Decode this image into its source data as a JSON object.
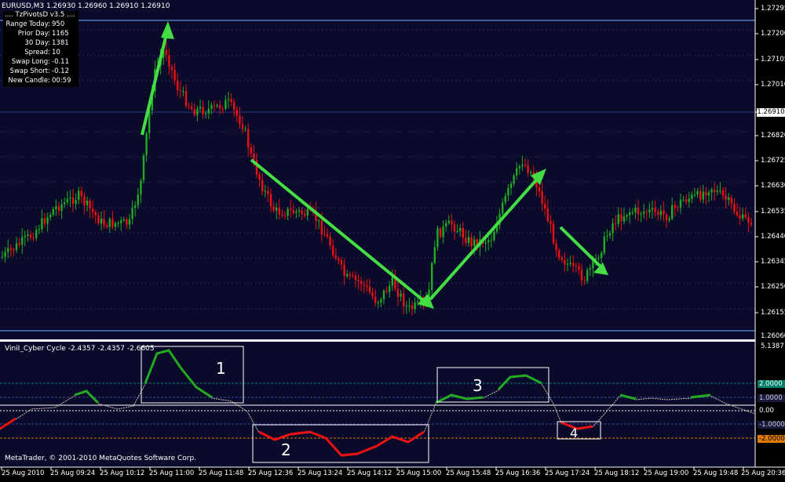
{
  "window": {
    "symbol_line": "EURUSD,M3  1.26930 1.26960 1.26910 1.26910",
    "indicator_title": "ViniI_Cyber Cycle -2.4357 -2.4357 -2.6605",
    "copyright": "MetaTrader, © 2001-2010 MetaQuotes Software Corp."
  },
  "pivots": {
    "header": ".... TzPivotsD v3.5 ....",
    "rows": [
      {
        "label": "Range Today:",
        "value": "950"
      },
      {
        "label": "Prior Day:",
        "value": "1165"
      },
      {
        "label": "30 Day:",
        "value": "1381"
      },
      {
        "label": "Spread:",
        "value": "10"
      },
      {
        "label": "Swap Long:",
        "value": "-0.11"
      },
      {
        "label": "Swap Short:",
        "value": "-0.12"
      },
      {
        "label": "New Candle:",
        "value": "00:59"
      }
    ]
  },
  "price_axis": {
    "labels": [
      "1.27295",
      "1.27200",
      "1.27105",
      "1.27010",
      "1.26820",
      "1.26725",
      "1.26630",
      "1.26535",
      "1.26440",
      "1.26345",
      "1.26250",
      "1.26155",
      "1.26060"
    ],
    "current": "1.26910"
  },
  "indicator_axis": {
    "top": "5.1387",
    "levels": [
      {
        "text": "2.0000",
        "bg": "#00806a",
        "fg": "#ffffff"
      },
      {
        "text": "1.0000",
        "bg": "#1a1a40",
        "fg": "#cccccc"
      },
      {
        "text": "0.00",
        "bg": "#000000",
        "fg": "#ffffff"
      },
      {
        "text": "-1.0000",
        "bg": "#1a1a40",
        "fg": "#cccccc"
      },
      {
        "text": "-2.0000",
        "bg": "#e07b00",
        "fg": "#000000"
      }
    ]
  },
  "time_axis": [
    "25 Aug 2010",
    "25 Aug 09:24",
    "25 Aug 10:12",
    "25 Aug 11:00",
    "25 Aug 11:48",
    "25 Aug 12:36",
    "25 Aug 13:24",
    "25 Aug 14:12",
    "25 Aug 15:00",
    "25 Aug 15:48",
    "25 Aug 16:36",
    "25 Aug 17:24",
    "25 Aug 18:12",
    "25 Aug 19:00",
    "25 Aug 19:48",
    "25 Aug 20:36"
  ],
  "annotations": {
    "box_labels": [
      "1",
      "2",
      "3",
      "4"
    ]
  },
  "colors": {
    "chart_bg": "#0a0a2a",
    "bull": "#22aa22",
    "bear": "#ee1111",
    "arrow": "#44dd44",
    "grid": "#1e2a5a"
  }
}
